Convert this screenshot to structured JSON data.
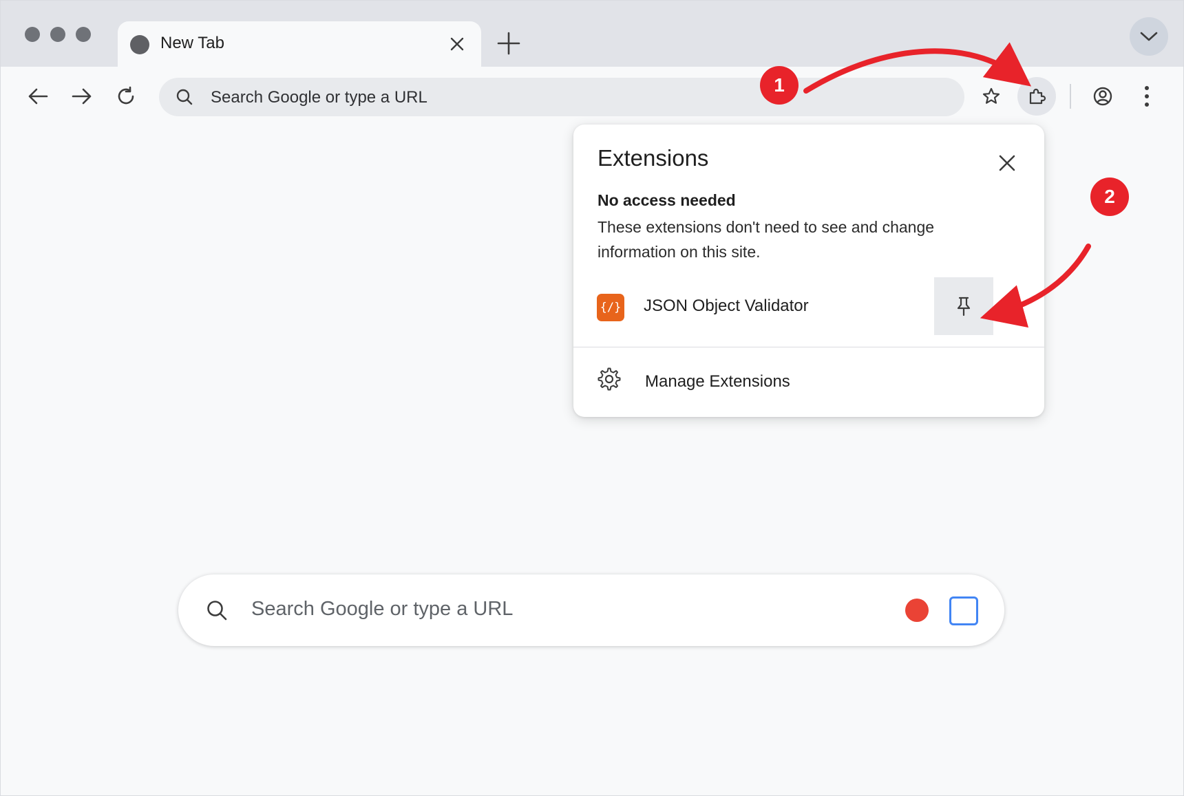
{
  "tab": {
    "title": "New Tab"
  },
  "omnibox": {
    "placeholder": "Search Google or type a URL"
  },
  "extensions_popup": {
    "title": "Extensions",
    "section_heading": "No access needed",
    "section_description": "These extensions don't need to see and change information on this site.",
    "extensions": [
      {
        "name": "JSON Object Validator",
        "icon_glyph": "{/}",
        "icon_color": "#e8641b"
      }
    ],
    "manage_label": "Manage Extensions"
  },
  "ntp_search": {
    "placeholder": "Search Google or type a URL"
  },
  "annotations": {
    "step1": "1",
    "step2": "2",
    "color": "#e8232a"
  },
  "colors": {
    "tabstrip": "#e1e3e8",
    "page": "#f8f9fa",
    "omnibox": "#e8eaed",
    "lens": "#4285f4",
    "voice": "#ea4335"
  },
  "icons": [
    "back-icon",
    "forward-icon",
    "reload-icon",
    "search-icon",
    "star-icon",
    "puzzle-icon",
    "account-icon",
    "kebab-icon",
    "pin-icon",
    "gear-icon",
    "close-icon",
    "plus-icon",
    "chevron-down-icon"
  ]
}
